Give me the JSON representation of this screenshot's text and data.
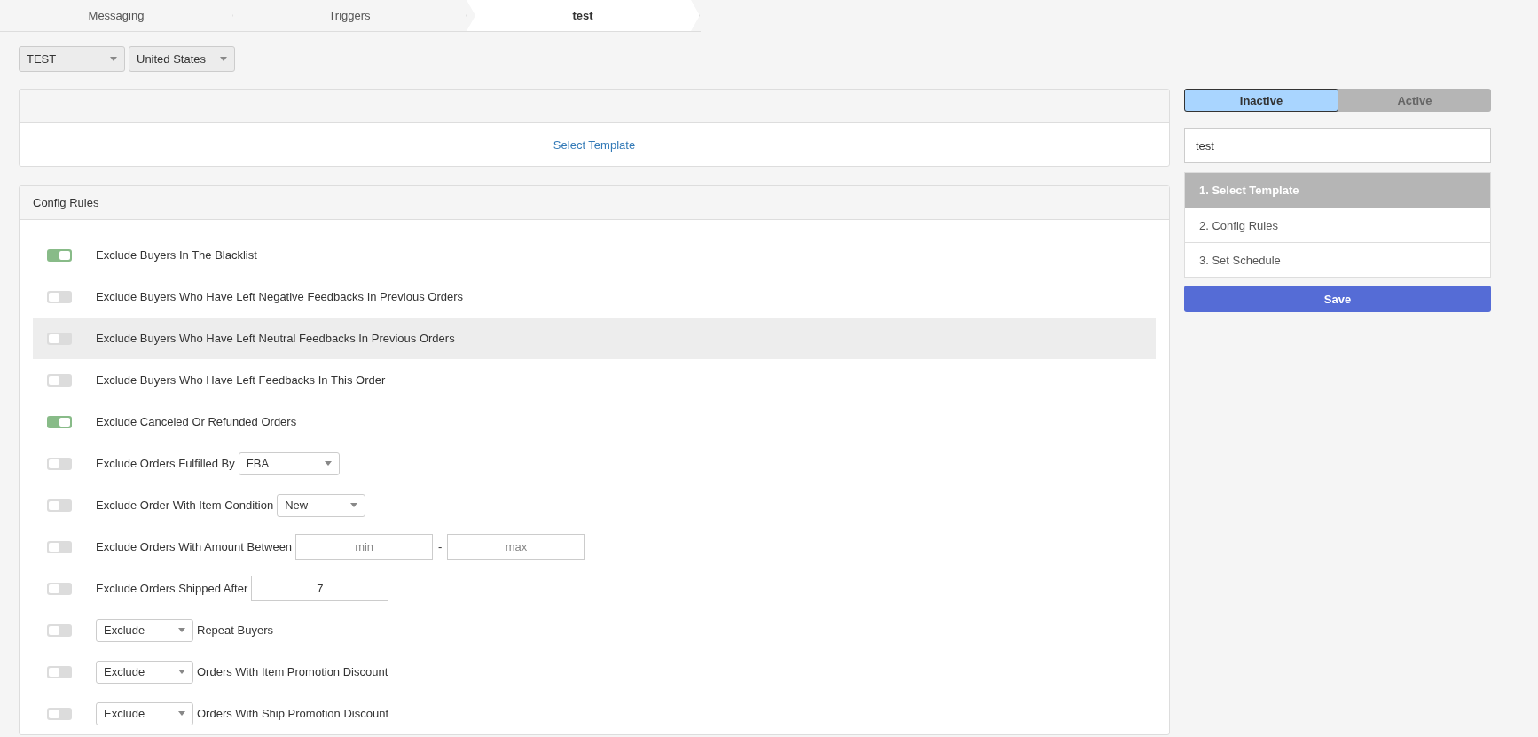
{
  "breadcrumb": [
    {
      "label": "Messaging",
      "selected": false
    },
    {
      "label": "Triggers",
      "selected": false
    },
    {
      "label": "test",
      "selected": true
    }
  ],
  "filters": [
    {
      "value": "TEST"
    },
    {
      "value": "United States"
    }
  ],
  "template_panel": {
    "link": "Select Template"
  },
  "config_panel": {
    "title": "Config Rules",
    "rules": [
      {
        "kind": "text",
        "on": true,
        "highlighted": false,
        "label": "Exclude Buyers In The Blacklist"
      },
      {
        "kind": "text",
        "on": false,
        "highlighted": false,
        "label": "Exclude Buyers Who Have Left Negative Feedbacks In Previous Orders"
      },
      {
        "kind": "text",
        "on": false,
        "highlighted": true,
        "label": "Exclude Buyers Who Have Left Neutral Feedbacks In Previous Orders"
      },
      {
        "kind": "text",
        "on": false,
        "highlighted": false,
        "label": "Exclude Buyers Who Have Left Feedbacks In This Order"
      },
      {
        "kind": "text",
        "on": true,
        "highlighted": false,
        "label": "Exclude Canceled Or Refunded Orders"
      },
      {
        "kind": "label_select",
        "on": false,
        "highlighted": false,
        "label": "Exclude Orders Fulfilled By",
        "select": "FBA"
      },
      {
        "kind": "label_select",
        "on": false,
        "highlighted": false,
        "label": "Exclude Order With Item Condition",
        "select": "New"
      },
      {
        "kind": "range",
        "on": false,
        "highlighted": false,
        "label": "Exclude Orders With Amount Between",
        "min_placeholder": "min",
        "separator": "-",
        "max_placeholder": "max"
      },
      {
        "kind": "label_input",
        "on": false,
        "highlighted": false,
        "label": "Exclude Orders Shipped After",
        "value": "7"
      },
      {
        "kind": "select_label",
        "on": false,
        "highlighted": false,
        "select": "Exclude",
        "label": "Repeat Buyers"
      },
      {
        "kind": "select_label",
        "on": false,
        "highlighted": false,
        "select": "Exclude",
        "label": "Orders With Item Promotion Discount"
      },
      {
        "kind": "select_label",
        "on": false,
        "highlighted": false,
        "select": "Exclude",
        "label": "Orders With Ship Promotion Discount"
      }
    ]
  },
  "status_switch": [
    {
      "label": "Inactive",
      "selected": true
    },
    {
      "label": "Active",
      "selected": false
    }
  ],
  "name_field": {
    "value": "test"
  },
  "steps": [
    {
      "label": "1. Select Template",
      "selected": true
    },
    {
      "label": "2. Config Rules",
      "selected": false
    },
    {
      "label": "3. Set Schedule",
      "selected": false
    }
  ],
  "save_button": {
    "label": "Save"
  }
}
